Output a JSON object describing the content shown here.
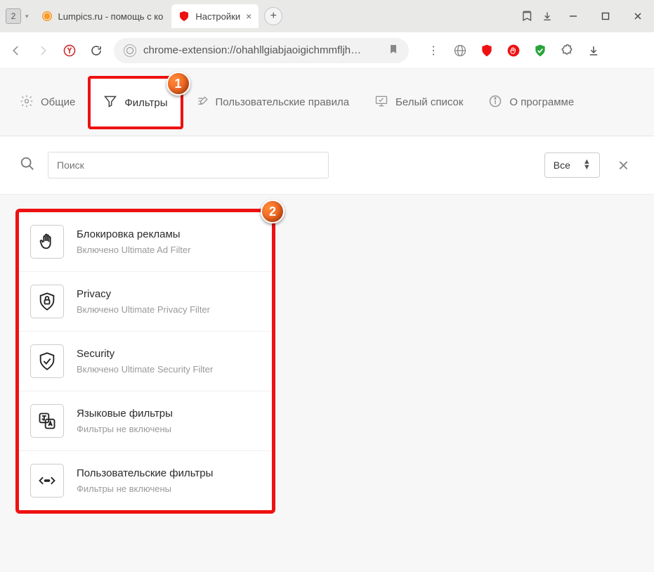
{
  "titlebar": {
    "tab_count": "2",
    "tabs": [
      {
        "label": "Lumpics.ru - помощь с ко",
        "active": false
      },
      {
        "label": "Настройки",
        "active": true
      }
    ]
  },
  "urlbar": {
    "url": "chrome-extension://ohahllgiabjaoigichmmfljh…"
  },
  "nav_tabs": {
    "items": [
      {
        "label": "Общие"
      },
      {
        "label": "Фильтры"
      },
      {
        "label": "Пользовательские правила"
      },
      {
        "label": "Белый список"
      },
      {
        "label": "О программе"
      }
    ]
  },
  "callouts": {
    "one": "1",
    "two": "2"
  },
  "search": {
    "placeholder": "Поиск",
    "dropdown_value": "Все"
  },
  "filters": [
    {
      "title": "Блокировка рекламы",
      "sub": "Включено Ultimate Ad Filter"
    },
    {
      "title": "Privacy",
      "sub": "Включено Ultimate Privacy Filter"
    },
    {
      "title": "Security",
      "sub": "Включено Ultimate Security Filter"
    },
    {
      "title": "Языковые фильтры",
      "sub": "Фильтры не включены"
    },
    {
      "title": "Пользовательские фильтры",
      "sub": "Фильтры не включены"
    }
  ]
}
